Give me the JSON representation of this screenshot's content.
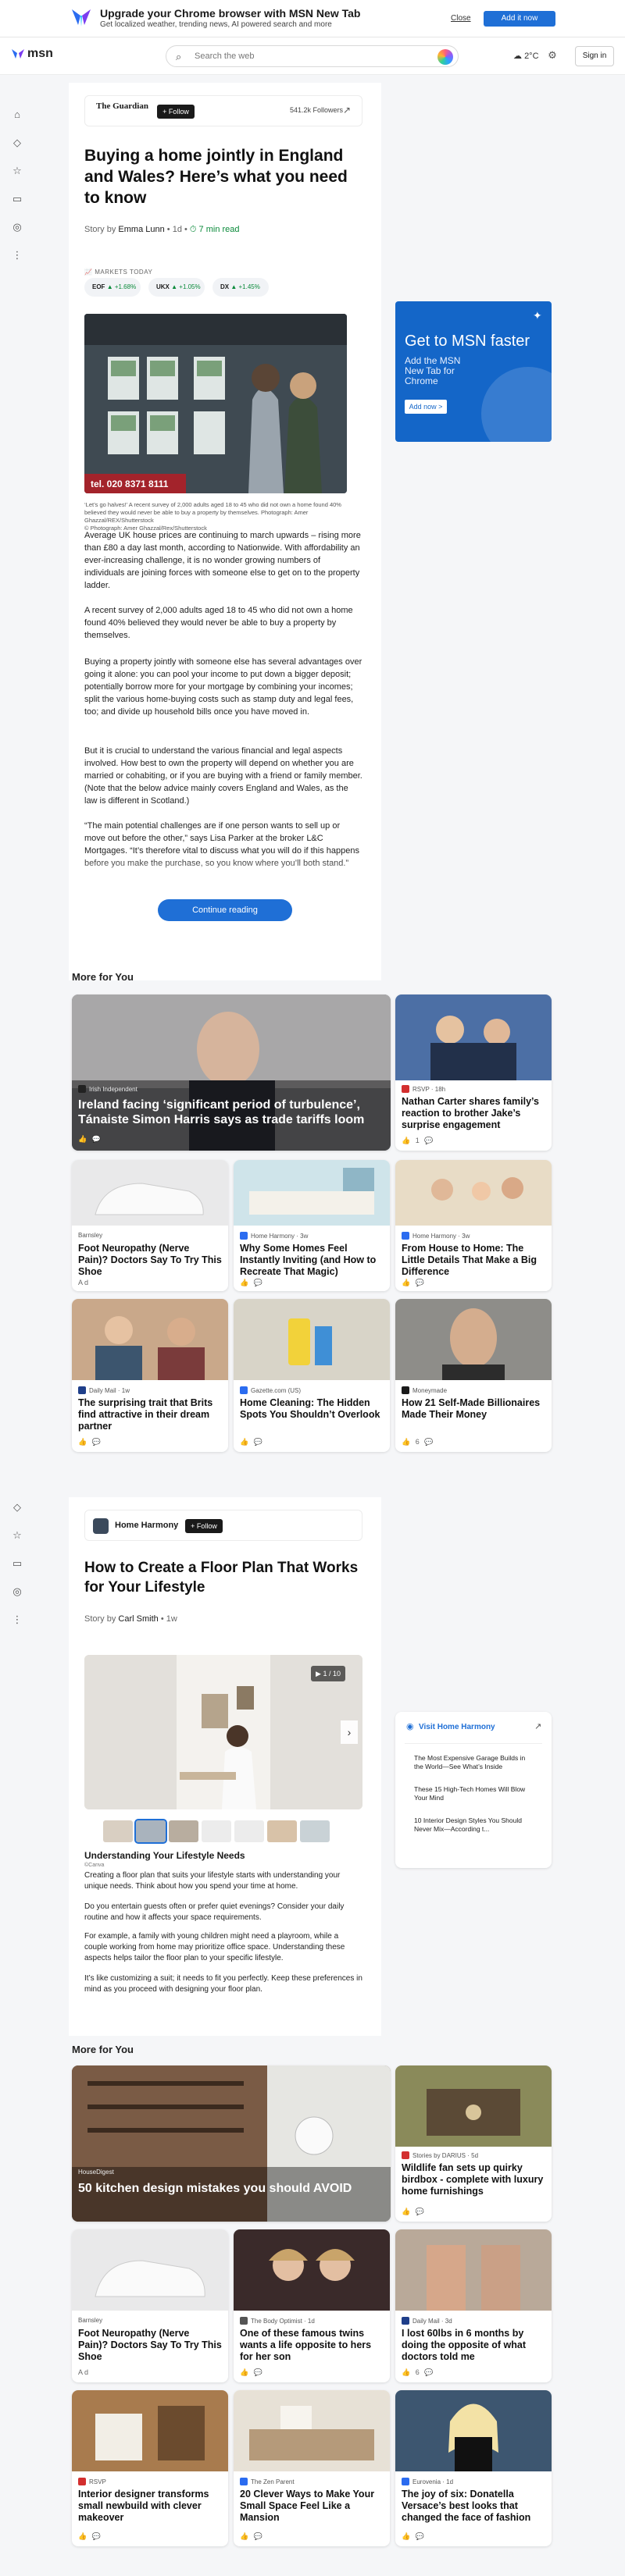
{
  "banner": {
    "title": "Upgrade your Chrome browser with MSN New Tab",
    "subtitle": "Get localized weather, trending news, AI powered search and more",
    "close_label": "Close",
    "add_label": "Add it now"
  },
  "header": {
    "logo": "msn",
    "search_placeholder": "Search the web",
    "weather": "2°C",
    "signin_label": "Sign in"
  },
  "article1": {
    "publisher": "The Guardian",
    "follow_label": "+ Follow",
    "followers": "541.2k Followers",
    "title": "Buying a home jointly in England and Wales? Here’s what you need to know",
    "byline_prefix": "Story by",
    "author": "Emma Lunn",
    "age": "• 1d •",
    "read_time": "⏱ 7 min read",
    "markets_label": "MARKETS TODAY",
    "tickers": [
      {
        "symbol": "EOF",
        "change": "▲ +1.68%"
      },
      {
        "symbol": "UKX",
        "change": "▲ +1.05%"
      },
      {
        "symbol": "DX",
        "change": "▲ +1.45%"
      }
    ],
    "caption": "‘Let’s go halves!’ A recent survey of 2,000 adults aged 18 to 45 who did not own a home found 40% believed they would never be able to buy a property by themselves. Photograph: Amer Ghazzal/REX/Shutterstock",
    "caption_credit": "© Photograph: Amer Ghazzal/Rex/Shutterstock",
    "paragraphs": [
      "Average UK house prices are continuing to march upwards – rising more than £80 a day last month, according to Nationwide. With affordability an ever-increasing challenge, it is no wonder growing numbers of individuals are joining forces with someone else to get on to the property ladder.",
      "A recent survey of 2,000 adults aged 18 to 45 who did not own a home found 40% believed they would never be able to buy a property by themselves.",
      "Buying a property jointly with someone else has several advantages over going it alone: you can pool your income to put down a bigger deposit; potentially borrow more for your mortgage by combining your incomes; split the various home-buying costs such as stamp duty and legal fees, too; and divide up household bills once you have moved in.",
      "But it is crucial to understand the various financial and legal aspects involved. How best to own the property will depend on whether you are married or cohabiting, or if you are buying with a friend or family member. (Note that the below advice mainly covers England and Wales, as the law is different in Scotland.)",
      "“The main potential challenges are if one person wants to sell up or move out before the other,” says Lisa Parker at the broker L&C Mortgages. “It’s therefore vital to discuss what you will do if this happens before you make the purchase, so you know where you’ll both stand.”"
    ],
    "continue_label": "Continue reading"
  },
  "ad": {
    "title": "Get to MSN faster",
    "text": "Add the MSN New Tab for Chrome",
    "button": "Add now >"
  },
  "more1": {
    "heading": "More for You",
    "tiles": [
      {
        "source": "Irish Independent",
        "title": "Ireland facing ‘significant period of turbulence’, Tánaiste Simon Harris says as trade tariffs loom",
        "reactions": "👍 💬"
      },
      {
        "source": "RSVP · 18h",
        "title": "Nathan Carter shares family’s reaction to brother Jake’s surprise engagement",
        "reactions": "👍 1 💬"
      },
      {
        "source": "Barnsley",
        "title": "Foot Neuropathy (Nerve Pain)? Doctors Say To Try This Shoe",
        "reactions": "Ad"
      },
      {
        "source": "Home Harmony · 3w",
        "title": "Why Some Homes Feel Instantly Inviting (and How to Recreate That Magic)",
        "reactions": "👍 💬"
      },
      {
        "source": "Home Harmony · 3w",
        "title": "From House to Home: The Little Details That Make a Big Difference",
        "reactions": "👍 💬"
      },
      {
        "source": "Daily Mail · 1w",
        "title": "The surprising trait that Brits find attractive in their dream partner",
        "reactions": "👍 💬"
      },
      {
        "source": "Gazette.com (US)",
        "title": "Home Cleaning: The Hidden Spots You Shouldn’t Overlook",
        "reactions": "👍 💬"
      },
      {
        "source": "Moneymade",
        "title": "How 21 Self-Made Billionaires Made Their Money",
        "reactions": "👍 6 💬"
      }
    ]
  },
  "article2": {
    "publisher": "Home Harmony",
    "follow_label": "+ Follow",
    "title": "How to Create a Floor Plan That Works for Your Lifestyle",
    "byline_prefix": "Story by",
    "author": "Carl Smith",
    "age": "• 1w",
    "slide_counter": "1 / 10",
    "section_title": "Understanding Your Lifestyle Needs",
    "section_credit": "©Canva",
    "paragraphs": [
      "Creating a floor plan that suits your lifestyle starts with understanding your unique needs. Think about how you spend your time at home.",
      "Do you entertain guests often or prefer quiet evenings? Consider your daily routine and how it affects your space requirements.",
      "For example, a family with young children might need a playroom, while a couple working from home may prioritize office space. Understanding these aspects helps tailor the floor plan to your specific lifestyle.",
      "It’s like customizing a suit; it needs to fit you perfectly. Keep these preferences in mind as you proceed with designing your floor plan."
    ]
  },
  "sidebar2": {
    "heading": "Visit Home Harmony",
    "items": [
      "The Most Expensive Garage Builds in the World—See What’s Inside",
      "These 15 High-Tech Homes Will Blow Your Mind",
      "10 Interior Design Styles You Should Never Mix—According t..."
    ]
  },
  "more2": {
    "heading": "More for You",
    "tiles": [
      {
        "source": "HouseDigest",
        "title": "50 kitchen design mistakes you should AVOID",
        "reactions": ""
      },
      {
        "source": "Stories by DARIUS · 5d",
        "title": "Wildlife fan sets up quirky birdbox - complete with luxury home furnishings",
        "reactions": "👍 💬"
      },
      {
        "source": "Barnsley",
        "title": "Foot Neuropathy (Nerve Pain)? Doctors Say To Try This Shoe",
        "reactions": "Ad"
      },
      {
        "source": "The Body Optimist · 1d",
        "title": "One of these famous twins wants a life opposite to hers for her son",
        "reactions": "👍 💬"
      },
      {
        "source": "Daily Mail · 3d",
        "title": "I lost 60lbs in 6 months by doing the opposite of what doctors told me",
        "reactions": "👍 6 💬"
      },
      {
        "source": "RSVP",
        "title": "Interior designer transforms small newbuild with clever makeover",
        "reactions": "👍 💬"
      },
      {
        "source": "The Zen Parent",
        "title": "20 Clever Ways to Make Your Small Space Feel Like a Mansion",
        "reactions": "👍 💬"
      },
      {
        "source": "Eurovenia · 1d",
        "title": "The joy of six: Donatella Versace’s best looks that changed the face of fashion",
        "reactions": "👍 💬"
      }
    ]
  }
}
